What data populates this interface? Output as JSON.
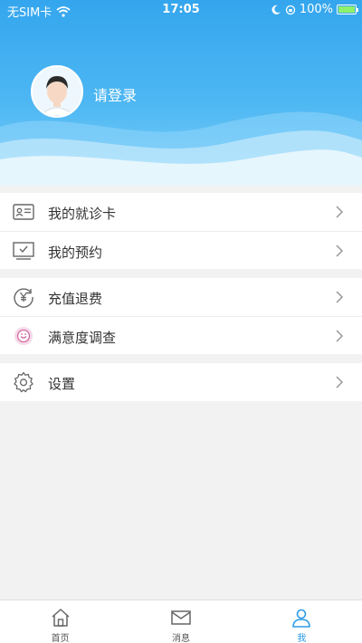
{
  "status_bar": {
    "carrier": "无SIM卡",
    "time": "17:05",
    "battery": "100%"
  },
  "profile": {
    "login_label": "请登录"
  },
  "menu": {
    "group1": [
      {
        "label": "我的就诊卡",
        "icon": "id-card-icon"
      },
      {
        "label": "我的预约",
        "icon": "monitor-check-icon"
      }
    ],
    "group2": [
      {
        "label": "充值退费",
        "icon": "yen-refund-icon"
      },
      {
        "label": "满意度调查",
        "icon": "smiley-survey-icon"
      }
    ],
    "group3": [
      {
        "label": "设置",
        "icon": "gear-icon"
      }
    ]
  },
  "tabbar": [
    {
      "label": "首页",
      "icon": "home-icon"
    },
    {
      "label": "消息",
      "icon": "envelope-icon"
    },
    {
      "label": "我",
      "icon": "user-icon",
      "active": true
    }
  ],
  "colors": {
    "header": "#34a6ee",
    "accent": "#2e9be6",
    "background": "#f2f2f2"
  }
}
